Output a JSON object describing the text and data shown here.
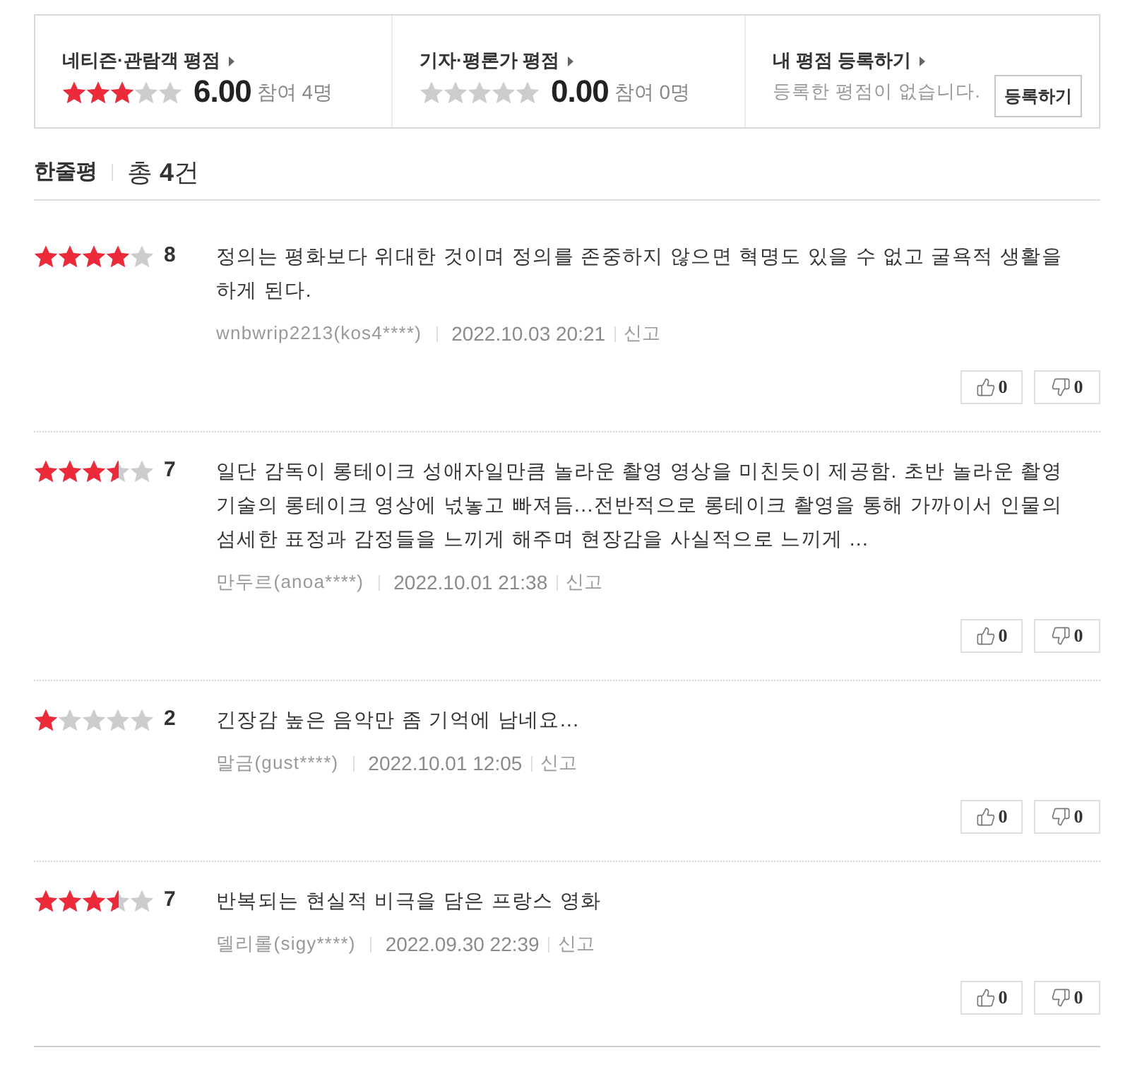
{
  "ratings": [
    {
      "title": "네티즌·관람객 평점",
      "stars": 3,
      "score": "6.00",
      "participants": "참여 4명"
    },
    {
      "title": "기자·평론가 평점",
      "stars": 0,
      "score": "0.00",
      "participants": "참여 0명"
    }
  ],
  "my_rating": {
    "title": "내 평점 등록하기",
    "message": "등록한 평점이 없습니다.",
    "button": "등록하기"
  },
  "reviews_header": {
    "title": "한줄평",
    "total": "총 **4**건"
  },
  "reviews": [
    {
      "stars": 4,
      "score": "8",
      "text": "정의는 평화보다 위대한 것이며 정의를 존중하지 않으면 혁명도 있을 수 없고 굴욕적 생활을 하게 된다.",
      "author": "wnbwrip2213(kos4****)",
      "date": "2022.10.03 20:21",
      "report": "신고",
      "likes": "0",
      "dislikes": "0"
    },
    {
      "stars": 3.5,
      "score": "7",
      "text": "일단 감독이 롱테이크 성애자일만큼 놀라운 촬영 영상을 미친듯이 제공함. 초반 놀라운 촬영 기술의 롱테이크 영상에 넋놓고 빠져듬...전반적으로 롱테이크 촬영을 통해 가까이서 인물의 섬세한 표정과 감정들을 느끼게 해주며 현장감을 사실적으로 느끼게 ...",
      "author": "만두르(anoa****)",
      "date": "2022.10.01 21:38",
      "report": "신고",
      "likes": "0",
      "dislikes": "0"
    },
    {
      "stars": 1,
      "score": "2",
      "text": "긴장감 높은 음악만 좀 기억에 남네요...",
      "author": "말금(gust****)",
      "date": "2022.10.01 12:05",
      "report": "신고",
      "likes": "0",
      "dislikes": "0"
    },
    {
      "stars": 3.5,
      "score": "7",
      "text": "반복되는 현실적 비극을 담은 프랑스 영화",
      "author": "델리롤(sigy****)",
      "date": "2022.09.30 22:39",
      "report": "신고",
      "likes": "0",
      "dislikes": "0"
    }
  ]
}
